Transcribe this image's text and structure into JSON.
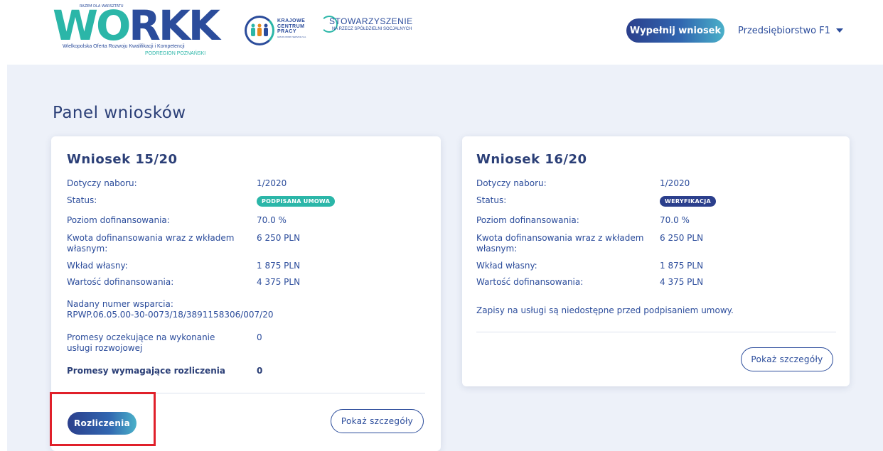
{
  "header": {
    "logo": {
      "brand": "WORKK",
      "tag": "RAZEM DLA WARSZTATU",
      "subtitle": "Wielkopolska Oferta Rozwoju Kwalifikacji i Kompetencji",
      "region": "PODREGION POZNAŃSKI"
    },
    "partner1": {
      "line1": "KRAJOWE",
      "line2": "CENTRUM",
      "line3": "PRACY",
      "small": "GRUPA WORK SERVICE S.A."
    },
    "partner2": {
      "title": "STOWARZYSZENIE",
      "subtitle": "NA RZECZ SPÓŁDZIELNI SOCJALNYCH"
    },
    "fill_button": "Wypełnij wniosek",
    "company": "Przedsiębiorstwo F1"
  },
  "page": {
    "title": "Panel wniosków"
  },
  "applications": [
    {
      "title": "Wniosek 15/20",
      "rows": {
        "recruitment_label": "Dotyczy naboru:",
        "recruitment_value": "1/2020",
        "status_label": "Status:",
        "status_value": "PODPISANA UMOWA",
        "level_label": "Poziom dofinansowania:",
        "level_value": "70.0 %",
        "amount_label": "Kwota dofinansowania wraz z wkładem własnym:",
        "amount_value": "6 250 PLN",
        "own_label": "Wkład własny:",
        "own_value": "1 875 PLN",
        "grant_label": "Wartość dofinansowania:",
        "grant_value": "4 375 PLN",
        "support_label": "Nadany numer wsparcia:",
        "support_value": "RPWP.06.05.00-30-0073/18/3891158306/007/20",
        "pending_label": "Promesy oczekujące na wykonanie usługi rozwojowej",
        "pending_value": "0",
        "settle_label": "Promesy wymagające rozliczenia",
        "settle_value": "0"
      },
      "settle_button": "Rozliczenia",
      "details_button": "Pokaż szczegóły"
    },
    {
      "title": "Wniosek 16/20",
      "rows": {
        "recruitment_label": "Dotyczy naboru:",
        "recruitment_value": "1/2020",
        "status_label": "Status:",
        "status_value": "WERYFIKACJA",
        "level_label": "Poziom dofinansowania:",
        "level_value": "70.0 %",
        "amount_label": "Kwota dofinansowania wraz z wkładem własnym:",
        "amount_value": "6 250 PLN",
        "own_label": "Wkład własny:",
        "own_value": "1 875 PLN",
        "grant_label": "Wartość dofinansowania:",
        "grant_value": "4 375 PLN",
        "notice": "Zapisy na usługi są niedostępne przed podpisaniem umowy."
      },
      "details_button": "Pokaż szczegóły"
    }
  ],
  "colors": {
    "primary": "#2b4c9b",
    "teal": "#2bb6a8",
    "highlight": "#e0202a",
    "background": "#edf1f9"
  }
}
